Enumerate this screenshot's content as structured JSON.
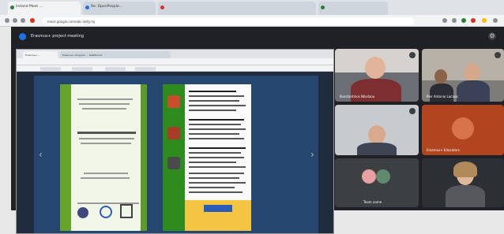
{
  "browser": {
    "tabs": [
      {
        "label": "Ireland Meet ..."
      },
      {
        "label": "Re: OpenPeople..."
      },
      {
        "label": ""
      },
      {
        "label": ""
      }
    ],
    "address": "meet.google.com/abc-defg-hij"
  },
  "meet": {
    "title": "Erasmus+ project meeting",
    "shared_window": {
      "tabs": [
        {
          "label": "Erasmus+ ..."
        },
        {
          "label": "Erasmus+ Program ... Dashboard"
        }
      ]
    },
    "participants": [
      {
        "name": "Konstantinos Nikolaou"
      },
      {
        "name": "Pier Antonio Lacava"
      },
      {
        "name": ""
      },
      {
        "name": "Erasmus+ Educators"
      },
      {
        "name": "Team name"
      },
      {
        "name": ""
      }
    ]
  },
  "colors": {
    "accent": "#1a73e8",
    "meet_bg": "#202124",
    "doc_green": "#66a52b"
  }
}
